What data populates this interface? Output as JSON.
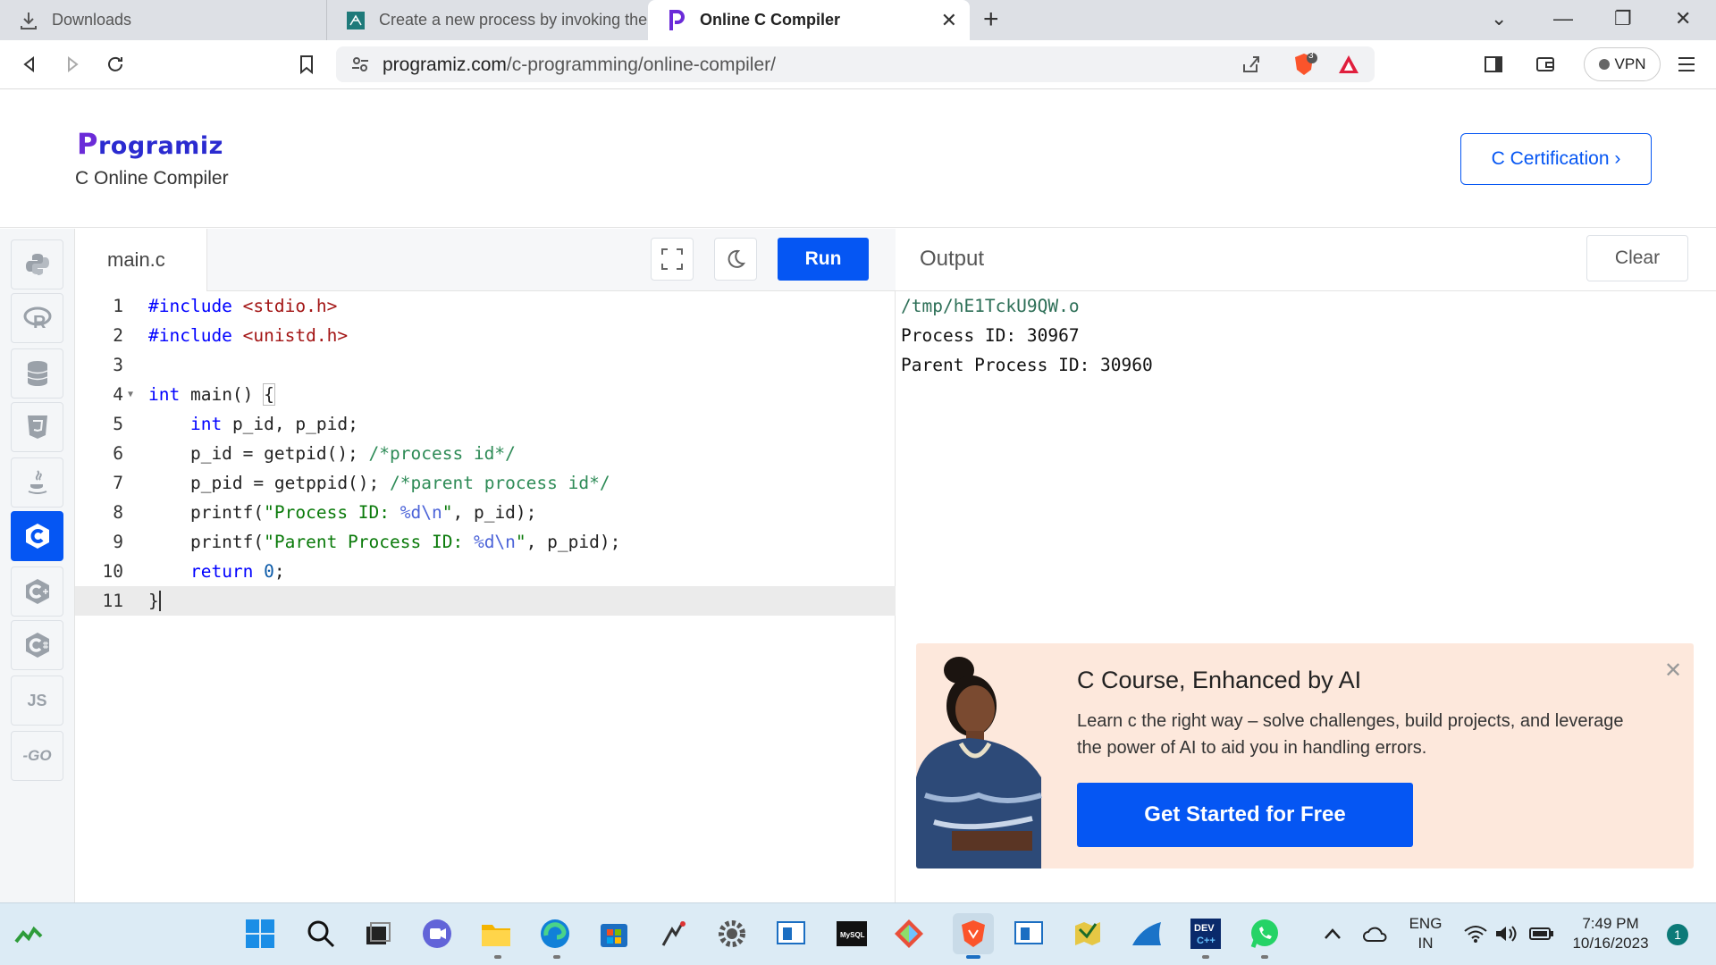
{
  "browser": {
    "tabs": [
      {
        "label": "Downloads",
        "icon": "download-icon"
      },
      {
        "label": "Create a new process by invoking the",
        "icon": "site-favicon"
      },
      {
        "label": "Online C Compiler",
        "icon": "programiz-favicon"
      }
    ],
    "url_domain": "programiz.com",
    "url_path": "/c-programming/online-compiler/",
    "shield_count": "3",
    "vpn_label": "VPN"
  },
  "header": {
    "logo_first": "P",
    "logo_rest": "rogramiz",
    "subtitle": "C Online Compiler",
    "cert_button": "C Certification ›"
  },
  "rail": {
    "languages": [
      {
        "name": "python",
        "icon": "python-icon"
      },
      {
        "name": "r",
        "icon": "r-icon",
        "text": "R"
      },
      {
        "name": "sql",
        "icon": "database-icon"
      },
      {
        "name": "html",
        "icon": "html5-icon",
        "text": "5"
      },
      {
        "name": "java",
        "icon": "java-icon"
      },
      {
        "name": "c",
        "icon": "c-icon",
        "text": "C",
        "active": true
      },
      {
        "name": "cpp",
        "icon": "cpp-icon",
        "text": "C"
      },
      {
        "name": "csharp",
        "icon": "csharp-icon",
        "text": "C"
      },
      {
        "name": "js",
        "icon": "js-icon",
        "text": "JS"
      },
      {
        "name": "go",
        "icon": "go-icon",
        "text": "-GO"
      }
    ]
  },
  "editor": {
    "file_name": "main.c",
    "run_label": "Run",
    "line_numbers": [
      "1",
      "2",
      "3",
      "4",
      "5",
      "6",
      "7",
      "8",
      "9",
      "10",
      "11"
    ],
    "lines": [
      "#include <stdio.h>",
      "#include <unistd.h>",
      "",
      "int main() {",
      "    int p_id, p_pid;",
      "    p_id = getpid(); /*process id*/",
      "    p_pid = getppid(); /*parent process id*/",
      "    printf(\"Process ID: %d\\n\", p_id);",
      "    printf(\"Parent Process ID: %d\\n\", p_pid);",
      "    return 0;",
      "}"
    ]
  },
  "output": {
    "title": "Output",
    "clear_label": "Clear",
    "lines": [
      "/tmp/hE1TckU9QW.o",
      "Process ID: 30967",
      "Parent Process ID: 30960"
    ]
  },
  "promo": {
    "title": "C Course, Enhanced by AI",
    "description": "Learn c the right way – solve challenges, build projects, and leverage the power of AI to aid you in handling errors.",
    "button": "Get Started for Free"
  },
  "taskbar": {
    "lang_top": "ENG",
    "lang_bottom": "IN",
    "time": "7:49 PM",
    "date": "10/16/2023",
    "notifications": "1"
  },
  "colors": {
    "accent": "#0556f3",
    "logo_purple": "#6b2bd8",
    "promo_bg": "#fde8dc"
  }
}
